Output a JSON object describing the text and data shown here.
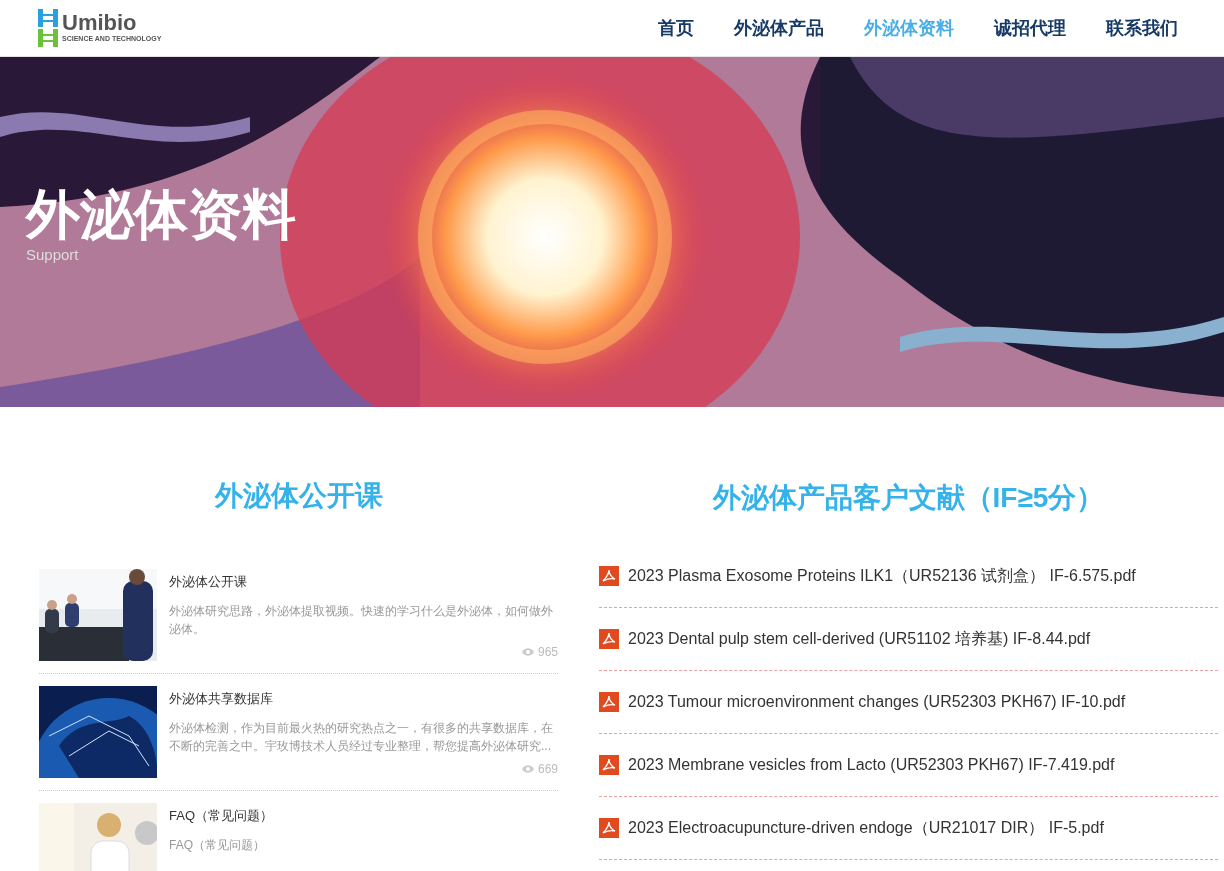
{
  "logo": {
    "name": "Umibio",
    "tagline": "SCIENCE AND TECHNOLOGY"
  },
  "nav": [
    {
      "label": "首页",
      "selected": false
    },
    {
      "label": "外泌体产品",
      "selected": false
    },
    {
      "label": "外泌体资料",
      "selected": true
    },
    {
      "label": "诚招代理",
      "selected": false
    },
    {
      "label": "联系我们",
      "selected": false
    }
  ],
  "banner": {
    "title": "外泌体资料",
    "subtitle": "Support"
  },
  "courses": {
    "heading": "外泌体公开课",
    "items": [
      {
        "title": "外泌体公开课",
        "description": "外泌体研究思路，外泌体提取视频。快速的学习什么是外泌体，如何做外泌体。",
        "views": "965",
        "kind": "meeting"
      },
      {
        "title": "外泌体共享数据库",
        "description": "外泌体检测，作为目前最火热的研究热点之一，有很多的共享数据库，在不断的完善之中。宇玫博技术人员经过专业整理，帮您提高外泌体研究...",
        "views": "669",
        "kind": "globe"
      },
      {
        "title": "FAQ（常见问题）",
        "description": "FAQ（常见问题）",
        "kind": "doctor"
      }
    ]
  },
  "papers": {
    "heading": "外泌体产品客户文献（IF≥5分）",
    "items": [
      "2023 Plasma Exosome Proteins ILK1（UR52136 试剂盒） IF-6.575.pdf",
      "2023 Dental pulp stem cell-derived (UR51102 培养基) IF-8.44.pdf",
      "2023 Tumour microenvironment changes (UR52303 PKH67) IF-10.pdf",
      "2023 Membrane vesicles from Lacto (UR52303 PKH67) IF-7.419.pdf",
      "2023 Electroacupuncture-driven endoge（UR21017 DIR） IF-5.pdf"
    ]
  }
}
